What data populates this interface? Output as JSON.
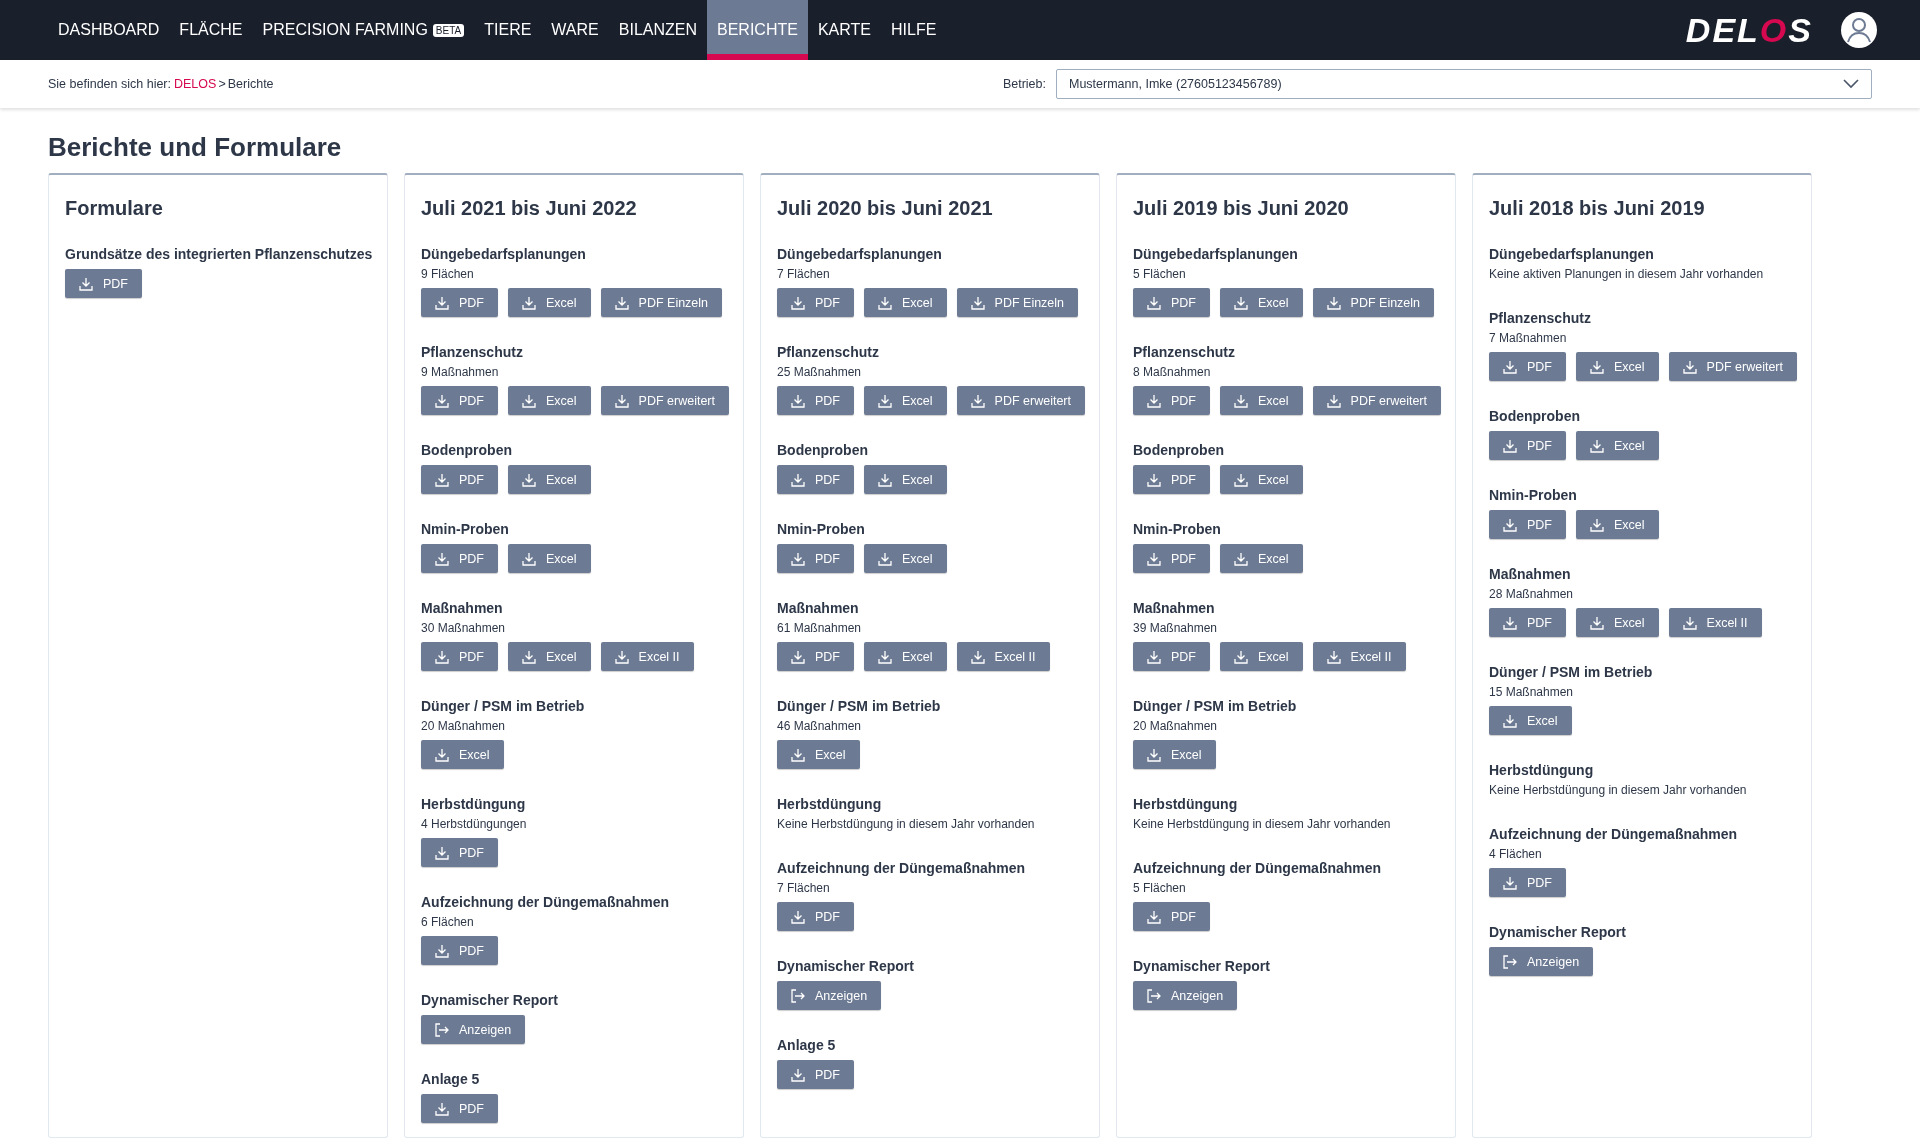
{
  "nav": {
    "items": [
      {
        "label": "DASHBOARD",
        "selected": false
      },
      {
        "label": "FLÄCHE",
        "selected": false
      },
      {
        "label": "PRECISION FARMING",
        "badge": "BETA",
        "selected": false
      },
      {
        "label": "TIERE",
        "selected": false
      },
      {
        "label": "WARE",
        "selected": false
      },
      {
        "label": "BILANZEN",
        "selected": false
      },
      {
        "label": "BERICHTE",
        "selected": true
      },
      {
        "label": "KARTE",
        "selected": false
      },
      {
        "label": "HILFE",
        "selected": false
      }
    ],
    "logo": [
      {
        "text": "DEL",
        "accent": false
      },
      {
        "text": "O",
        "accent": true
      },
      {
        "text": "S",
        "accent": false
      }
    ]
  },
  "breadcrumb": {
    "prefix": "Sie befinden sich hier:",
    "items": [
      "DELOS",
      "Berichte"
    ],
    "separator": ">"
  },
  "betrieb": {
    "label": "Betrieb:",
    "value": "Mustermann, Imke (27605123456789)"
  },
  "page_title": "Berichte und Formulare",
  "columns": [
    {
      "title": "Formulare",
      "sections": [
        {
          "title": "Grundsätze des integrierten Pflanzenschutzes",
          "buttons": [
            {
              "label": "PDF",
              "kind": "download"
            }
          ]
        }
      ]
    },
    {
      "title": "Juli 2021 bis Juni 2022",
      "sections": [
        {
          "title": "Düngebedarfsplanungen",
          "note": "9 Flächen",
          "buttons": [
            {
              "label": "PDF",
              "kind": "download"
            },
            {
              "label": "Excel",
              "kind": "download"
            },
            {
              "label": "PDF Einzeln",
              "kind": "download"
            }
          ]
        },
        {
          "title": "Pflanzenschutz",
          "note": "9 Maßnahmen",
          "buttons": [
            {
              "label": "PDF",
              "kind": "download"
            },
            {
              "label": "Excel",
              "kind": "download"
            },
            {
              "label": "PDF erweitert",
              "kind": "download"
            }
          ]
        },
        {
          "title": "Bodenproben",
          "buttons": [
            {
              "label": "PDF",
              "kind": "download"
            },
            {
              "label": "Excel",
              "kind": "download"
            }
          ]
        },
        {
          "title": "Nmin-Proben",
          "buttons": [
            {
              "label": "PDF",
              "kind": "download"
            },
            {
              "label": "Excel",
              "kind": "download"
            }
          ]
        },
        {
          "title": "Maßnahmen",
          "note": "30 Maßnahmen",
          "buttons": [
            {
              "label": "PDF",
              "kind": "download"
            },
            {
              "label": "Excel",
              "kind": "download"
            },
            {
              "label": "Excel II",
              "kind": "download"
            }
          ]
        },
        {
          "title": "Dünger / PSM im Betrieb",
          "note": "20 Maßnahmen",
          "buttons": [
            {
              "label": "Excel",
              "kind": "download"
            }
          ]
        },
        {
          "title": "Herbstdüngung",
          "note": "4 Herbstdüngungen",
          "buttons": [
            {
              "label": "PDF",
              "kind": "download"
            }
          ]
        },
        {
          "title": "Aufzeichnung der Düngemaßnahmen",
          "note": "6 Flächen",
          "buttons": [
            {
              "label": "PDF",
              "kind": "download"
            }
          ]
        },
        {
          "title": "Dynamischer Report",
          "buttons": [
            {
              "label": "Anzeigen",
              "kind": "open"
            }
          ]
        },
        {
          "title": "Anlage 5",
          "buttons": [
            {
              "label": "PDF",
              "kind": "download"
            }
          ]
        }
      ]
    },
    {
      "title": "Juli 2020 bis Juni 2021",
      "sections": [
        {
          "title": "Düngebedarfsplanungen",
          "note": "7 Flächen",
          "buttons": [
            {
              "label": "PDF",
              "kind": "download"
            },
            {
              "label": "Excel",
              "kind": "download"
            },
            {
              "label": "PDF Einzeln",
              "kind": "download"
            }
          ]
        },
        {
          "title": "Pflanzenschutz",
          "note": "25 Maßnahmen",
          "buttons": [
            {
              "label": "PDF",
              "kind": "download"
            },
            {
              "label": "Excel",
              "kind": "download"
            },
            {
              "label": "PDF erweitert",
              "kind": "download"
            }
          ]
        },
        {
          "title": "Bodenproben",
          "buttons": [
            {
              "label": "PDF",
              "kind": "download"
            },
            {
              "label": "Excel",
              "kind": "download"
            }
          ]
        },
        {
          "title": "Nmin-Proben",
          "buttons": [
            {
              "label": "PDF",
              "kind": "download"
            },
            {
              "label": "Excel",
              "kind": "download"
            }
          ]
        },
        {
          "title": "Maßnahmen",
          "note": "61 Maßnahmen",
          "buttons": [
            {
              "label": "PDF",
              "kind": "download"
            },
            {
              "label": "Excel",
              "kind": "download"
            },
            {
              "label": "Excel II",
              "kind": "download"
            }
          ]
        },
        {
          "title": "Dünger / PSM im Betrieb",
          "note": "46 Maßnahmen",
          "buttons": [
            {
              "label": "Excel",
              "kind": "download"
            }
          ]
        },
        {
          "title": "Herbstdüngung",
          "note": "Keine Herbstdüngung in diesem Jahr vorhanden"
        },
        {
          "title": "Aufzeichnung der Düngemaßnahmen",
          "note": "7 Flächen",
          "buttons": [
            {
              "label": "PDF",
              "kind": "download"
            }
          ]
        },
        {
          "title": "Dynamischer Report",
          "buttons": [
            {
              "label": "Anzeigen",
              "kind": "open"
            }
          ]
        },
        {
          "title": "Anlage 5",
          "buttons": [
            {
              "label": "PDF",
              "kind": "download"
            }
          ]
        }
      ]
    },
    {
      "title": "Juli 2019 bis Juni 2020",
      "sections": [
        {
          "title": "Düngebedarfsplanungen",
          "note": "5 Flächen",
          "buttons": [
            {
              "label": "PDF",
              "kind": "download"
            },
            {
              "label": "Excel",
              "kind": "download"
            },
            {
              "label": "PDF Einzeln",
              "kind": "download"
            }
          ]
        },
        {
          "title": "Pflanzenschutz",
          "note": "8 Maßnahmen",
          "buttons": [
            {
              "label": "PDF",
              "kind": "download"
            },
            {
              "label": "Excel",
              "kind": "download"
            },
            {
              "label": "PDF erweitert",
              "kind": "download"
            }
          ]
        },
        {
          "title": "Bodenproben",
          "buttons": [
            {
              "label": "PDF",
              "kind": "download"
            },
            {
              "label": "Excel",
              "kind": "download"
            }
          ]
        },
        {
          "title": "Nmin-Proben",
          "buttons": [
            {
              "label": "PDF",
              "kind": "download"
            },
            {
              "label": "Excel",
              "kind": "download"
            }
          ]
        },
        {
          "title": "Maßnahmen",
          "note": "39 Maßnahmen",
          "buttons": [
            {
              "label": "PDF",
              "kind": "download"
            },
            {
              "label": "Excel",
              "kind": "download"
            },
            {
              "label": "Excel II",
              "kind": "download"
            }
          ]
        },
        {
          "title": "Dünger / PSM im Betrieb",
          "note": "20 Maßnahmen",
          "buttons": [
            {
              "label": "Excel",
              "kind": "download"
            }
          ]
        },
        {
          "title": "Herbstdüngung",
          "note": "Keine Herbstdüngung in diesem Jahr vorhanden"
        },
        {
          "title": "Aufzeichnung der Düngemaßnahmen",
          "note": "5 Flächen",
          "buttons": [
            {
              "label": "PDF",
              "kind": "download"
            }
          ]
        },
        {
          "title": "Dynamischer Report",
          "buttons": [
            {
              "label": "Anzeigen",
              "kind": "open"
            }
          ]
        }
      ]
    },
    {
      "title": "Juli 2018 bis Juni 2019",
      "sections": [
        {
          "title": "Düngebedarfsplanungen",
          "note": "Keine aktiven Planungen in diesem Jahr vorhanden"
        },
        {
          "title": "Pflanzenschutz",
          "note": "7 Maßnahmen",
          "buttons": [
            {
              "label": "PDF",
              "kind": "download"
            },
            {
              "label": "Excel",
              "kind": "download"
            },
            {
              "label": "PDF erweitert",
              "kind": "download"
            }
          ]
        },
        {
          "title": "Bodenproben",
          "buttons": [
            {
              "label": "PDF",
              "kind": "download"
            },
            {
              "label": "Excel",
              "kind": "download"
            }
          ]
        },
        {
          "title": "Nmin-Proben",
          "buttons": [
            {
              "label": "PDF",
              "kind": "download"
            },
            {
              "label": "Excel",
              "kind": "download"
            }
          ]
        },
        {
          "title": "Maßnahmen",
          "note": "28 Maßnahmen",
          "buttons": [
            {
              "label": "PDF",
              "kind": "download"
            },
            {
              "label": "Excel",
              "kind": "download"
            },
            {
              "label": "Excel II",
              "kind": "download"
            }
          ]
        },
        {
          "title": "Dünger / PSM im Betrieb",
          "note": "15 Maßnahmen",
          "buttons": [
            {
              "label": "Excel",
              "kind": "download"
            }
          ]
        },
        {
          "title": "Herbstdüngung",
          "note": "Keine Herbstdüngung in diesem Jahr vorhanden"
        },
        {
          "title": "Aufzeichnung der Düngemaßnahmen",
          "note": "4 Flächen",
          "buttons": [
            {
              "label": "PDF",
              "kind": "download"
            }
          ]
        },
        {
          "title": "Dynamischer Report",
          "buttons": [
            {
              "label": "Anzeigen",
              "kind": "open"
            }
          ]
        }
      ]
    }
  ]
}
